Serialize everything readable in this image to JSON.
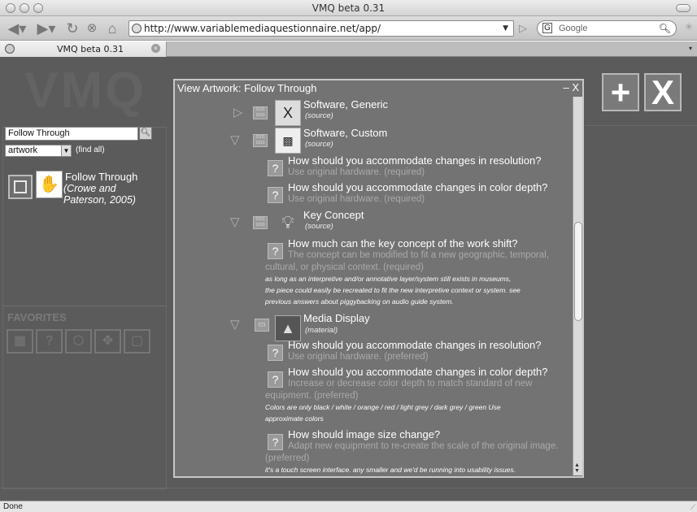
{
  "window": {
    "title": "VMQ beta 0.31"
  },
  "toolbar": {
    "url": "http://www.variablemediaquestionnaire.net/app/",
    "search_placeholder": "Google",
    "search_engine_icon": "google-g-icon"
  },
  "tab": {
    "label": "VMQ beta 0.31"
  },
  "app": {
    "logo": "VMQ",
    "search_value": "Follow Through",
    "filter_value": "artwork",
    "find_all": "(find all)",
    "result": {
      "title": "Follow Through",
      "subtitle": "(Crowe and Paterson, 2005)"
    },
    "favorites_label": "FAVORITES",
    "add_label": "+",
    "close_label": "X"
  },
  "modal": {
    "title": "View Artwork: Follow Through",
    "close": "– X",
    "components": [
      {
        "title": "Software, Generic",
        "source": "(source)"
      },
      {
        "title": "Software, Custom",
        "source": "(source)",
        "questions": [
          {
            "q": "How should you accommodate changes in resolution?",
            "a": "Use original hardware. (required)"
          },
          {
            "q": "How should you accommodate changes in color depth?",
            "a": "Use original hardware. (required)"
          }
        ]
      },
      {
        "title": "Key Concept",
        "source": "(source)",
        "questions": [
          {
            "q": "How much can the key concept of the work shift?",
            "a1": "The concept can be modified to fit a new geographic, temporal,",
            "a2": "cultural, or physical context. (required)",
            "note1": "as long as an interpretive and/or annotative layer/system still exists in museums,",
            "note2": "the piece could easily be recreated to fit the new interpretive context or system. see",
            "note3": "previous answers about piggybacking on audio guide system."
          }
        ]
      },
      {
        "title": "Media Display",
        "source": "(material)",
        "questions": [
          {
            "q": "How should you accommodate changes in resolution?",
            "a": "Use original hardware. (preferred)"
          },
          {
            "q": "How should you accommodate changes in color depth?",
            "a1": "Increase or decrease color depth to match standard of new",
            "a2": "equipment. (preferred)",
            "note1": "Colors are only black / white / orange / red / light grey / dark grey / green Use",
            "note2": "approximate colors"
          },
          {
            "q": "How should image size change?",
            "a1": "Adapt new equipment to re-create the scale of the original image.",
            "a2": "(preferred)",
            "note1": "it's a touch screen interface. any smaller and we'd be running into usability issues."
          }
        ]
      }
    ]
  },
  "status": {
    "text": "Done"
  }
}
